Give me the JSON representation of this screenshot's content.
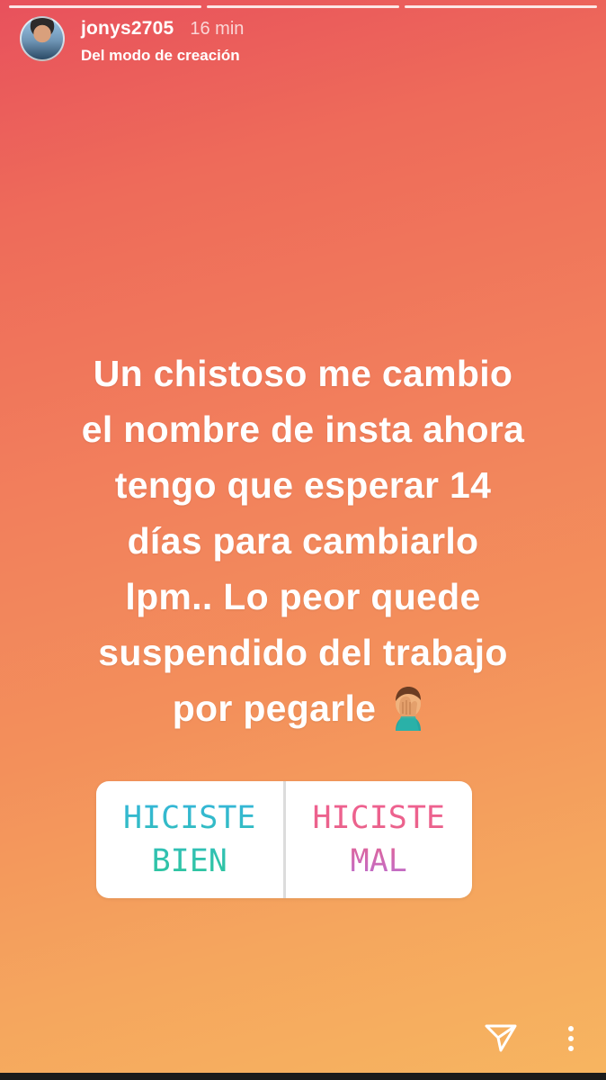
{
  "story": {
    "progress_segments": 3,
    "user": {
      "username": "jonys2705",
      "time": "16 min",
      "subtitle": "Del modo de creación",
      "avatar_icon": "profile-photo"
    },
    "message_lines": [
      "Un chistoso me cambio",
      "el nombre de insta ahora",
      "tengo que esperar 14",
      "días para cambiarlo",
      "lpm.. Lo peor quede",
      "suspendido del trabajo",
      "por pegarle"
    ],
    "message_emoji": "facepalm-emoji",
    "poll": {
      "option_a": {
        "line1": "HICISTE",
        "line2": "BIEN"
      },
      "option_b": {
        "line1": "HICISTE",
        "line2": "MAL"
      }
    },
    "footer": {
      "send_icon": "send-icon",
      "more_icon": "more-options-icon"
    }
  },
  "colors": {
    "gradient_top": "#e8515c",
    "gradient_bottom": "#f7b560",
    "poll_a_color": "#2ebfb0",
    "poll_b_color": "#e9628a"
  }
}
